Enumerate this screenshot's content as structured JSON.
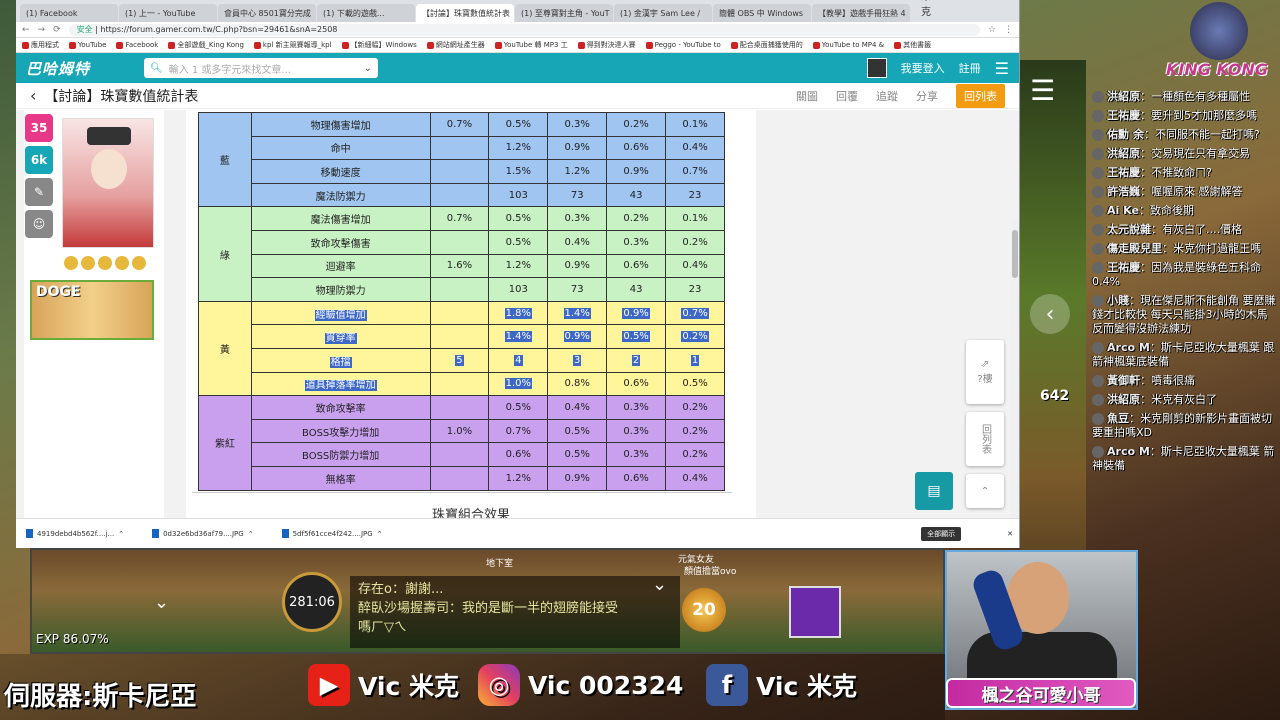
{
  "browser": {
    "tabs": [
      "(1) Facebook",
      "(1) 上一 - YouTube",
      "會員中心 8501寶分完成",
      "(1) 下載的遊戲...",
      "【討論】珠寶數值統計表",
      "(1) 至尊寶對主角 - YouT",
      "(1) 金漢宇 Sam Lee /",
      "簡體 OBS 中 Windows",
      "【教學】遊戲手冊狂熱 4"
    ],
    "window_controls": [
      "Vic米克",
      "—",
      "□",
      "✕"
    ],
    "security_label": "安全",
    "url": "https://forum.gamer.com.tw/C.php?bsn=29461&snA=2508",
    "bookmarks": [
      "應用程式",
      "YouTube",
      "Facebook",
      "全部遊戲_King Kong",
      "kpl 新主競賽報導_kpl",
      "【新細幅】Windows",
      "網站網址產生器",
      "YouTube 轉 MP3 工",
      "得到對決達人賽",
      "Peggo - YouTube to",
      "配合桌面捕獲使用的",
      "YouTube to MP4 &",
      "其他書籤"
    ]
  },
  "gamer": {
    "logo": "巴哈姆特",
    "search_placeholder": "輸入 1 或多字元來找文章...",
    "login": "我要登入",
    "register": "註冊",
    "back": "‹",
    "title": "【討論】珠寶數值統計表",
    "actions": [
      "關圖",
      "回覆",
      "追蹤",
      "分享"
    ],
    "primary_action": "回列表"
  },
  "sidebar": {
    "level_badge": "35",
    "level_sub": "LV",
    "gp_badge": "6k",
    "gp_sub": "GP",
    "doge_label": "DOGE"
  },
  "table": {
    "rows": [
      {
        "group": "藍",
        "color": "blue",
        "stat": "物理傷害增加",
        "v": [
          "0.7%",
          "0.5%",
          "0.3%",
          "0.2%",
          "0.1%"
        ],
        "sel": false
      },
      {
        "group": "",
        "color": "blue",
        "stat": "命中",
        "v": [
          "",
          "1.2%",
          "0.9%",
          "0.6%",
          "0.4%"
        ],
        "sel": false
      },
      {
        "group": "",
        "color": "blue",
        "stat": "移動速度",
        "v": [
          "",
          "1.5%",
          "1.2%",
          "0.9%",
          "0.7%"
        ],
        "sel": false
      },
      {
        "group": "",
        "color": "blue",
        "stat": "魔法防禦力",
        "v": [
          "",
          "103",
          "73",
          "43",
          "23"
        ],
        "sel": false
      },
      {
        "group": "綠",
        "color": "green",
        "stat": "魔法傷害增加",
        "v": [
          "0.7%",
          "0.5%",
          "0.3%",
          "0.2%",
          "0.1%"
        ],
        "sel": false
      },
      {
        "group": "",
        "color": "green",
        "stat": "致命攻擊傷害",
        "v": [
          "",
          "0.5%",
          "0.4%",
          "0.3%",
          "0.2%"
        ],
        "sel": false
      },
      {
        "group": "",
        "color": "green",
        "stat": "迴避率",
        "v": [
          "1.6%",
          "1.2%",
          "0.9%",
          "0.6%",
          "0.4%"
        ],
        "sel": false
      },
      {
        "group": "",
        "color": "green",
        "stat": "物理防禦力",
        "v": [
          "",
          "103",
          "73",
          "43",
          "23"
        ],
        "sel": false
      },
      {
        "group": "黃",
        "color": "yellow",
        "stat": "經驗值增加",
        "v": [
          "",
          "1.8%",
          "1.4%",
          "0.9%",
          "0.7%"
        ],
        "sel": true
      },
      {
        "group": "",
        "color": "yellow",
        "stat": "貫穿率",
        "v": [
          "",
          "1.4%",
          "0.9%",
          "0.5%",
          "0.2%"
        ],
        "sel": true
      },
      {
        "group": "",
        "color": "yellow",
        "stat": "格擋",
        "v": [
          "5",
          "4",
          "3",
          "2",
          "1"
        ],
        "sel": true
      },
      {
        "group": "",
        "color": "yellow",
        "stat": "道具掉落率增加",
        "v": [
          "",
          "1.0%",
          "0.8%",
          "0.6%",
          "0.5%"
        ],
        "sel": "partial"
      },
      {
        "group": "紫紅",
        "color": "purple",
        "stat": "致命攻擊率",
        "v": [
          "",
          "0.5%",
          "0.4%",
          "0.3%",
          "0.2%"
        ],
        "sel": false
      },
      {
        "group": "",
        "color": "purple",
        "stat": "BOSS攻擊力增加",
        "v": [
          "1.0%",
          "0.7%",
          "0.5%",
          "0.3%",
          "0.2%"
        ],
        "sel": false
      },
      {
        "group": "",
        "color": "purple",
        "stat": "BOSS防禦力增加",
        "v": [
          "",
          "0.6%",
          "0.5%",
          "0.3%",
          "0.2%"
        ],
        "sel": false
      },
      {
        "group": "",
        "color": "purple",
        "stat": "無格率",
        "v": [
          "",
          "1.2%",
          "0.9%",
          "0.6%",
          "0.4%"
        ],
        "sel": false
      }
    ],
    "section_title": "珠寶組合效果"
  },
  "floating": {
    "up_label": "?樓",
    "list_label": "回列表"
  },
  "downloads": {
    "files": [
      "4919debd4b562f....j...",
      "0d32e6bd36af79....JPG",
      "5df5f61cce4f242....JPG"
    ],
    "show_all": "全部顯示"
  },
  "game": {
    "timer": "281:06",
    "exp": "EXP 86.07%",
    "chat": [
      "存在o：謝謝...",
      "醉臥沙場握壽司：我的是斷一半的翅膀能接受",
      "嗎ㄏ▽ㄟ"
    ],
    "level": "20",
    "labels": [
      "地下室",
      "元氣女友",
      "顏值擔當ovo"
    ]
  },
  "stream": {
    "server": "伺服器:斯卡尼亞",
    "youtube": "Vic 米克",
    "instagram": "Vic 002324",
    "facebook": "Vic 米克",
    "cam_tag": "楓之谷可愛小哥",
    "side_number": "642",
    "brand": "KING KONG"
  },
  "chat": [
    {
      "who": "洪紹原",
      "text": "一種顏色有多種屬性"
    },
    {
      "who": "王祐慶",
      "text": "要升到5才加那麼多嗎"
    },
    {
      "who": "佑勳 余",
      "text": "不同服不能一起打嗎?"
    },
    {
      "who": "洪紹原",
      "text": "交易現在只有拿交易"
    },
    {
      "who": "王祐慶",
      "text": "不推致命ㄇ?"
    },
    {
      "who": "許浩巍",
      "text": "喔喔原來 感謝解答"
    },
    {
      "who": "Ai Ke",
      "text": "致命後期"
    },
    {
      "who": "太元說雜",
      "text": "有灰白了....價格"
    },
    {
      "who": "傷走殿兒里",
      "text": "米克你打過龍王嗎"
    },
    {
      "who": "王祐慶",
      "text": "因為我是裝綠色五科命0.4%"
    },
    {
      "who": "小賤",
      "text": "現在傑尼斯不能創角 要麼賺錢才比較快 每天只能掛3小時的木馬 反而變得沒辦法練功"
    },
    {
      "who": "Arco M",
      "text": "斯卡尼亞收大量楓葉 跟箭神楓葉底裝備"
    },
    {
      "who": "黃御軒",
      "text": "噴毒很痛"
    },
    {
      "who": "洪紹原",
      "text": "米克有灰白了"
    },
    {
      "who": "魚豆",
      "text": "米克剛剪的新影片畫面被切 要重拍嗎XD"
    },
    {
      "who": "Arco M",
      "text": "斯卡尼亞收大量楓葉 箭神裝備"
    }
  ]
}
